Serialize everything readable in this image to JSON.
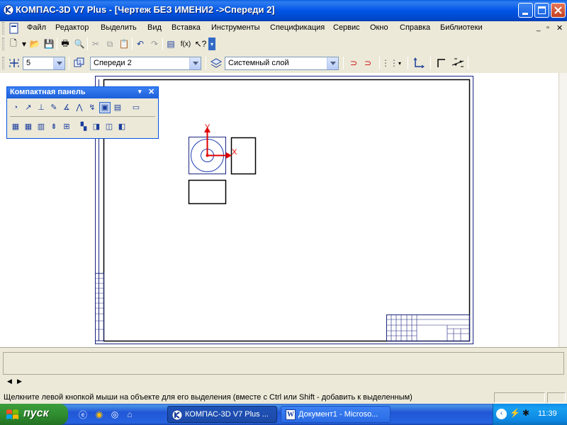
{
  "window": {
    "title": "КОМПАС-3D V7 Plus - [Чертеж БЕЗ ИМЕНИ2 ->Спереди 2]",
    "app_icon": "kompas-logo-icon"
  },
  "menu": [
    "Файл",
    "Редактор",
    "Выделить",
    "Вид",
    "Вставка",
    "Инструменты",
    "Спецификация",
    "Сервис",
    "Окно",
    "Справка",
    "Библиотеки"
  ],
  "toolbar2": {
    "step_value": "5",
    "view_value": "Спереди 2",
    "layer_value": "Системный слой"
  },
  "compact_panel": {
    "title": "Компактная панель",
    "row1_icons": [
      "geometry-icon",
      "dimension-icon",
      "symbol-icon",
      "edit-icon",
      "parametrize-icon",
      "measure-icon",
      "select-icon",
      "associative-view-icon",
      "spec-icon",
      "report-icon"
    ],
    "row2_icons": [
      "view-icon",
      "section-view-icon",
      "break-view-icon",
      "projection-icon",
      "local-view-icon",
      "associative-icon",
      "3d-view-icon",
      "arrow-view-icon",
      "partial-view-icon"
    ]
  },
  "axes": {
    "x_label": "X",
    "y_label": "Y"
  },
  "colors": {
    "frame": "#1a237e",
    "axis": "#e00000",
    "circle": "#1f3fb5"
  },
  "status": {
    "hint": "Щелкните левой кнопкой мыши на объекте для его выделения (вместе с Ctrl или Shift - добавить к выделенным)"
  },
  "taskbar": {
    "start_label": "пуск",
    "tasks": [
      "КОМПАС-3D V7 Plus ...",
      "Документ1 - Microso..."
    ],
    "clock": "11:39"
  }
}
